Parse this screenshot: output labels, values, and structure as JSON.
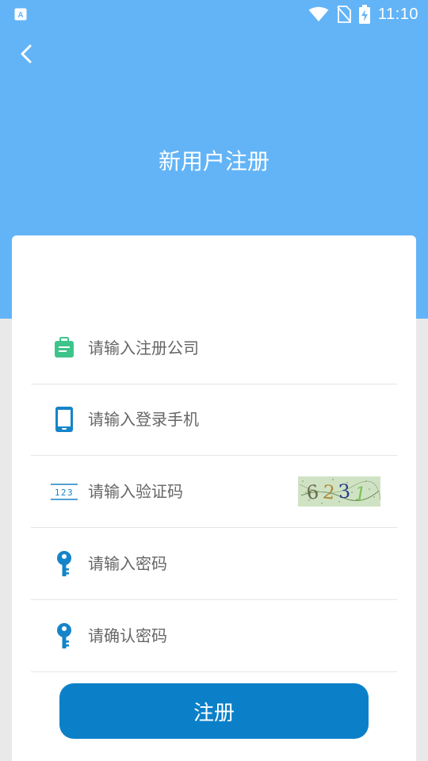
{
  "status_bar": {
    "time": "11:10",
    "icons": [
      "notification-a-icon",
      "wifi-icon",
      "no-sim-icon",
      "battery-charging-icon"
    ]
  },
  "header": {
    "back_icon": "back-chevron-icon",
    "title": "新用户注册"
  },
  "form": {
    "fields": [
      {
        "icon": "briefcase-icon",
        "placeholder": "请输入注册公司"
      },
      {
        "icon": "phone-icon",
        "placeholder": "请输入登录手机"
      },
      {
        "icon": "number-123-icon",
        "placeholder": "请输入验证码",
        "captcha_text": "6231"
      },
      {
        "icon": "key-icon",
        "placeholder": "请输入密码"
      },
      {
        "icon": "key-icon",
        "placeholder": "请确认密码"
      }
    ],
    "submit_label": "注册"
  },
  "colors": {
    "header_bg": "#63b4f7",
    "button_bg": "#0b80c9",
    "icon_blue": "#1684c8",
    "icon_green": "#3ec48b"
  }
}
